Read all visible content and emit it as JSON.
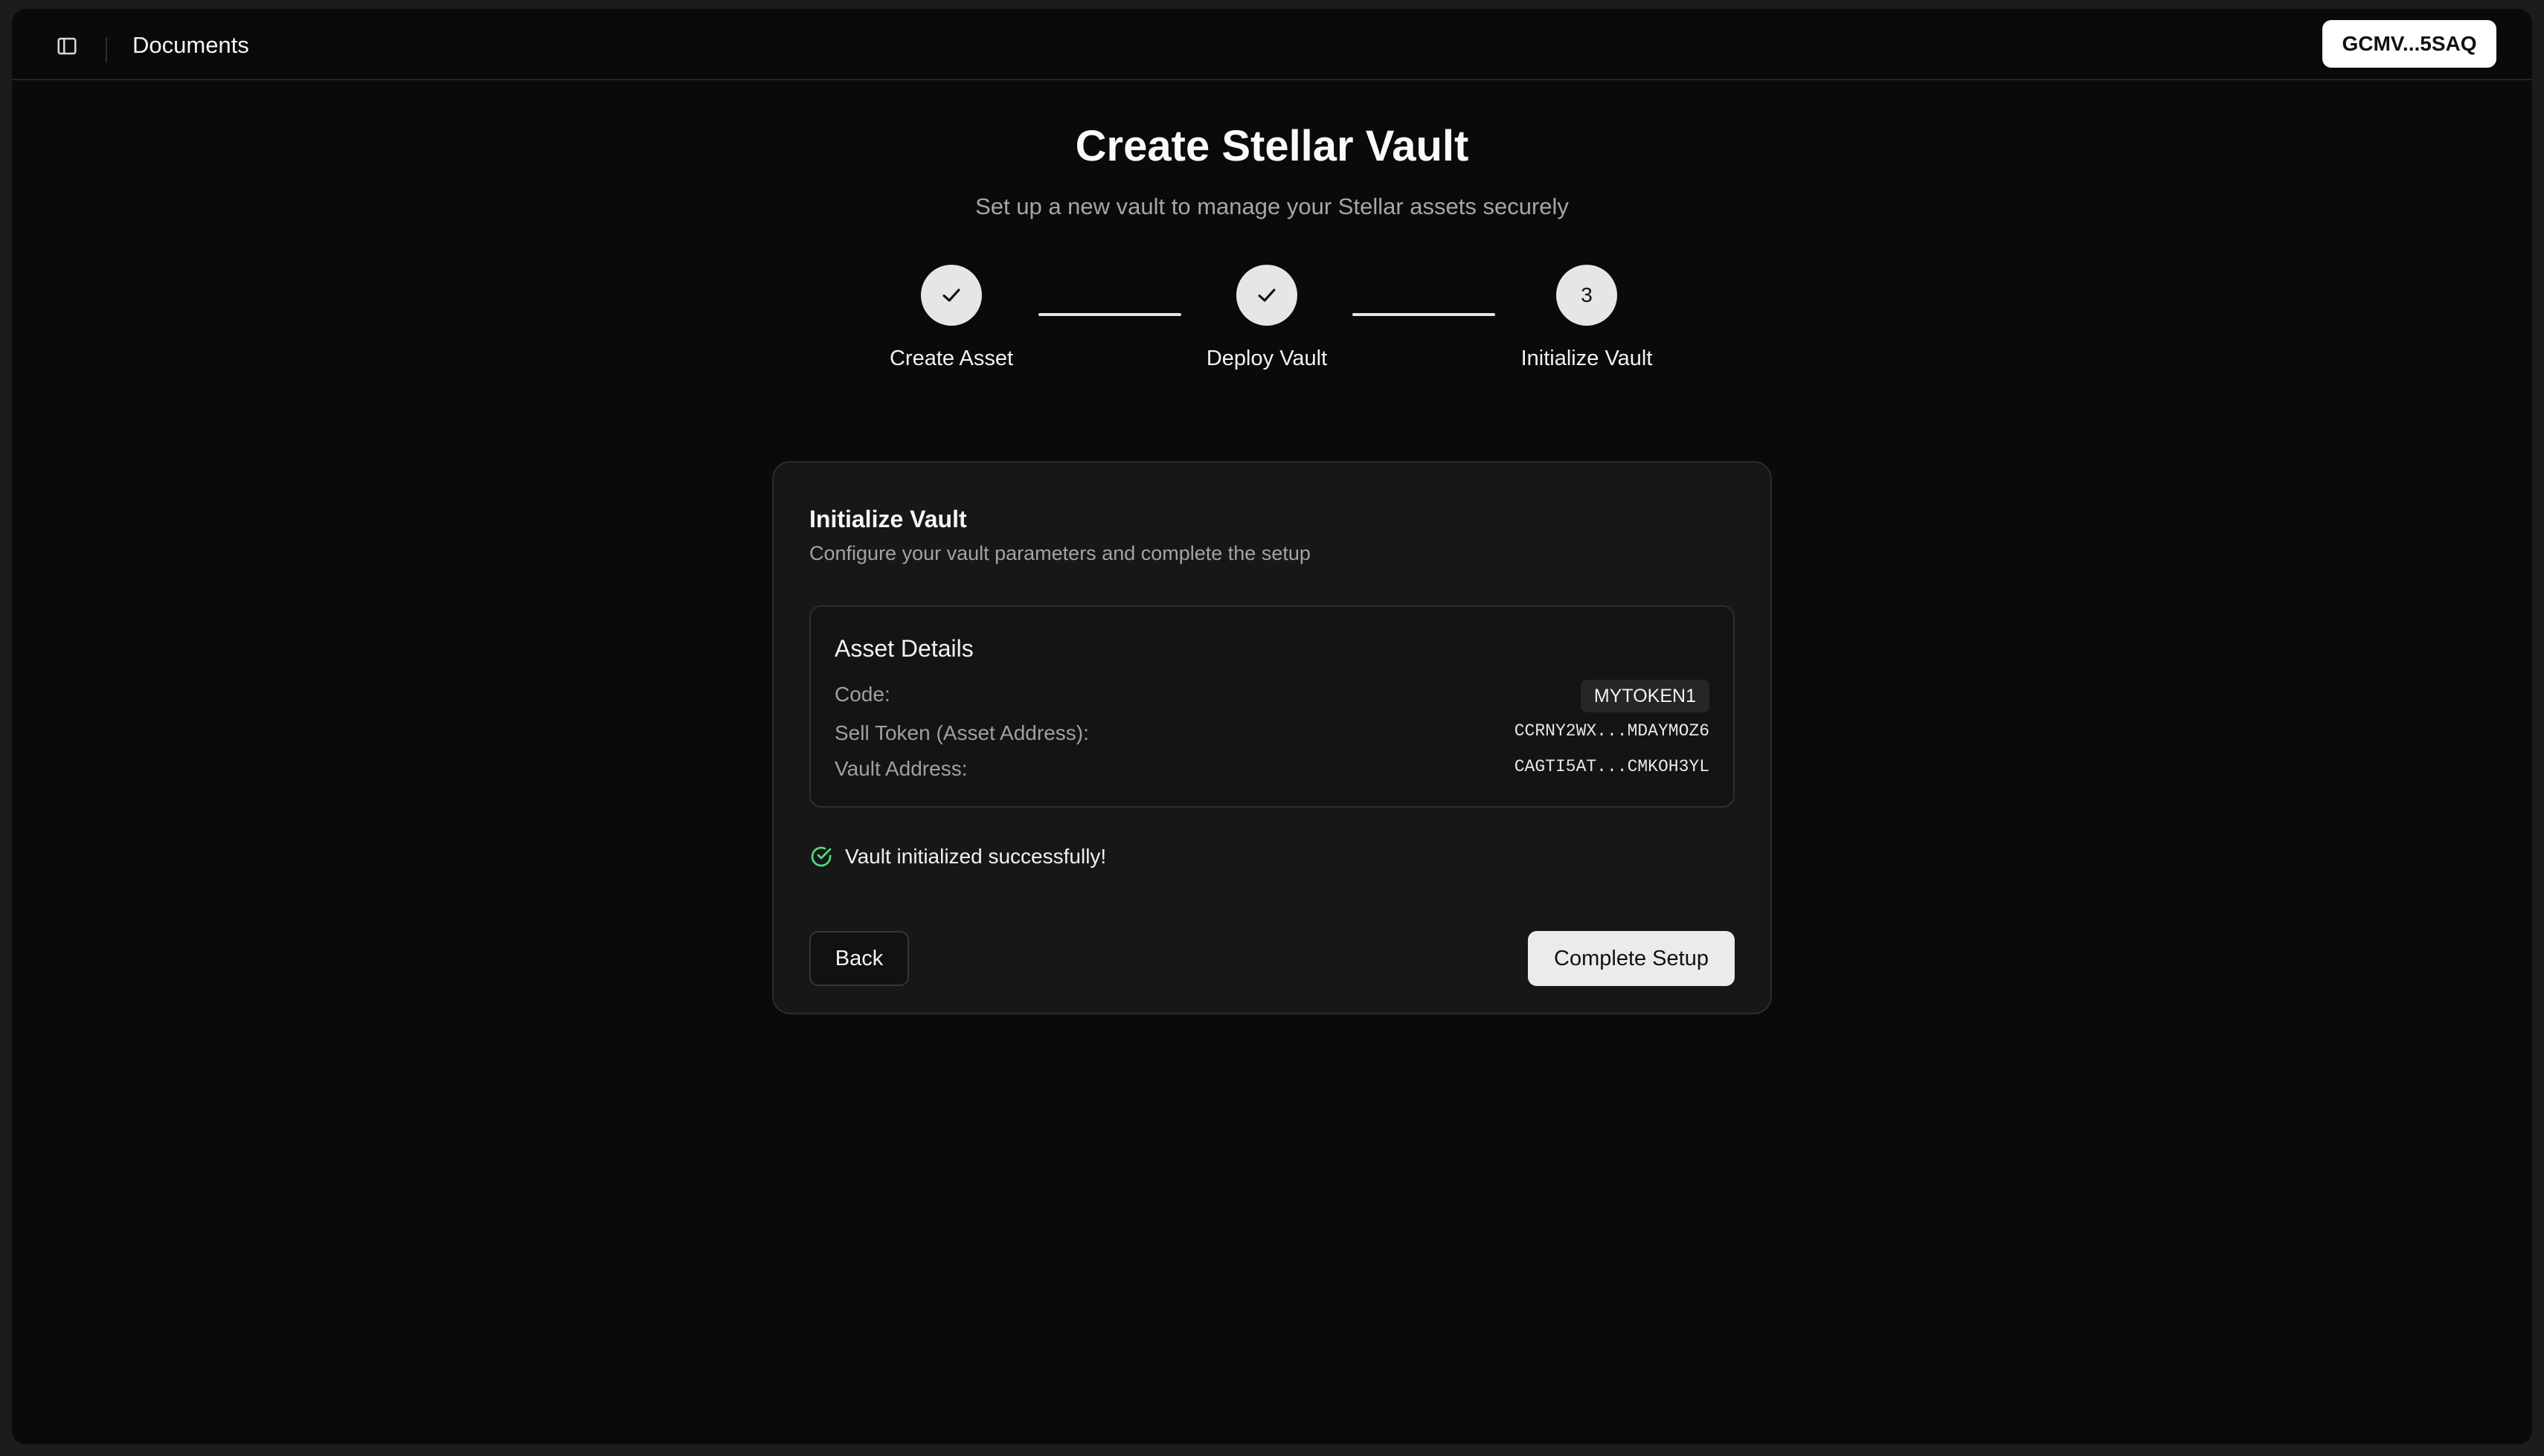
{
  "header": {
    "sidebar_toggle_icon": "sidebar-panel-icon",
    "title": "Documents",
    "wallet_address": "GCMV...5SAQ"
  },
  "page": {
    "title": "Create Stellar Vault",
    "subtitle": "Set up a new vault to manage your Stellar assets securely"
  },
  "stepper": {
    "steps": [
      {
        "label": "Create Asset",
        "state": "complete",
        "icon": "check-icon"
      },
      {
        "label": "Deploy Vault",
        "state": "complete",
        "icon": "check-icon"
      },
      {
        "label": "Initialize Vault",
        "state": "current",
        "number": "3"
      }
    ]
  },
  "card": {
    "title": "Initialize Vault",
    "description": "Configure your vault parameters and complete the setup",
    "asset_details": {
      "title": "Asset Details",
      "code_label": "Code:",
      "code_value": "MYTOKEN1",
      "sell_token_label": "Sell Token (Asset Address):",
      "sell_token_value": "CCRNY2WX...MDAYMOZ6",
      "vault_address_label": "Vault Address:",
      "vault_address_value": "CAGTI5AT...CMKOH3YL"
    },
    "status": {
      "icon": "check-circle-icon",
      "text": "Vault initialized successfully!",
      "color": "#4ade80"
    },
    "back_label": "Back",
    "complete_label": "Complete Setup"
  }
}
